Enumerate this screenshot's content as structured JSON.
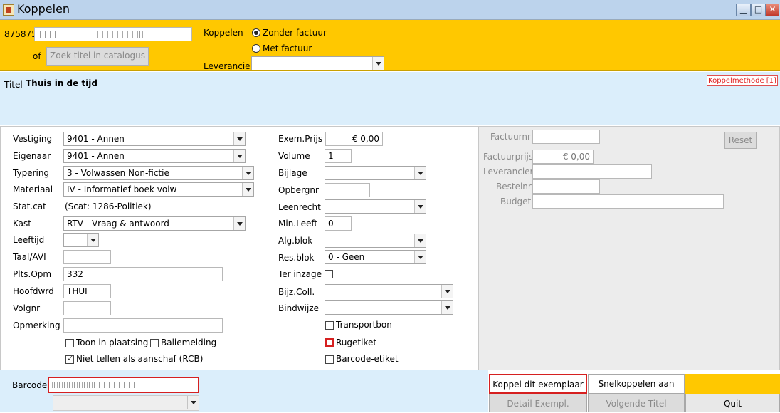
{
  "window": {
    "title": "Koppelen"
  },
  "header": {
    "code": "875875",
    "of_label": "of",
    "search_button": "Zoek titel in catalogus",
    "koppelen_label": "Koppelen",
    "radio_zonder": "Zonder factuur",
    "radio_met": "Met factuur",
    "selected": "Zonder factuur",
    "leverancier_label": "Leverancier",
    "leverancier_value": ""
  },
  "title_panel": {
    "label": "Titel",
    "value": "Thuis in de tijd",
    "sub": "-",
    "koppelmethode": "Koppelmethode [1]"
  },
  "left_fields": [
    {
      "label": "Vestiging",
      "value": "9401 - Annen"
    },
    {
      "label": "Eigenaar",
      "value": "9401 - Annen"
    },
    {
      "label": "Typering",
      "value": "3 - Volwassen Non-fictie"
    },
    {
      "label": "Materiaal",
      "value": "IV - Informatief boek volw"
    },
    {
      "label": "Stat.cat",
      "value": "(Scat: 1286-Politiek)"
    },
    {
      "label": "Kast",
      "value": "RTV - Vraag & antwoord"
    },
    {
      "label": "Leeftijd",
      "value": ""
    },
    {
      "label": "Taal/AVI",
      "value": ""
    },
    {
      "label": "Plts.Opm",
      "value": "332"
    },
    {
      "label": "Hoofdwrd",
      "value": "THUI"
    },
    {
      "label": "Volgnr",
      "value": ""
    },
    {
      "label": "Opmerking",
      "value": ""
    }
  ],
  "checkboxes_left": [
    {
      "label": "Toon in plaatsing",
      "checked": false
    },
    {
      "label": "Baliemelding",
      "checked": false
    },
    {
      "label": "Niet tellen als aanschaf (RCB)",
      "checked": true
    }
  ],
  "middle_fields": [
    {
      "label": "Exem.Prijs",
      "value": "€ 0,00"
    },
    {
      "label": "Volume",
      "value": "1"
    },
    {
      "label": "Bijlage",
      "value": ""
    },
    {
      "label": "Opbergnr",
      "value": ""
    },
    {
      "label": "Leenrecht",
      "value": ""
    },
    {
      "label": "Min.Leeft",
      "value": "0"
    },
    {
      "label": "Alg.blok",
      "value": ""
    },
    {
      "label": "Res.blok",
      "value": "0 - Geen"
    },
    {
      "label": "Ter inzage",
      "value": ""
    },
    {
      "label": "Bijz.Coll.",
      "value": ""
    },
    {
      "label": "Bindwijze",
      "value": ""
    }
  ],
  "checkboxes_middle": [
    {
      "label": "Transportbon",
      "checked": false
    },
    {
      "label": "Rugetiket",
      "checked": false
    },
    {
      "label": "Barcode-etiket",
      "checked": false
    }
  ],
  "right_panel": {
    "factuurnr_label": "Factuurnr",
    "factuurnr_value": "",
    "reset_button": "Reset",
    "factuurprijs_label": "Factuurprijs",
    "factuurprijs_value": "€ 0,00",
    "leverancier_label": "Leverancier",
    "leverancier_value": "",
    "bestelnr_label": "Bestelnr",
    "bestelnr_value": "",
    "budget_label": "Budget",
    "budget_value": ""
  },
  "bottom": {
    "barcode_label": "Barcode",
    "koppel_button": "Koppel dit exemplaar",
    "snelkoppelen_button": "Snelkoppelen aan",
    "detail_button": "Detail Exempl.",
    "volgende_button": "Volgende Titel",
    "quit_button": "Quit"
  },
  "colors": {
    "header_bg": "#ffc800",
    "panel_bg": "#dbeefb",
    "highlight_red": "#d62020"
  }
}
